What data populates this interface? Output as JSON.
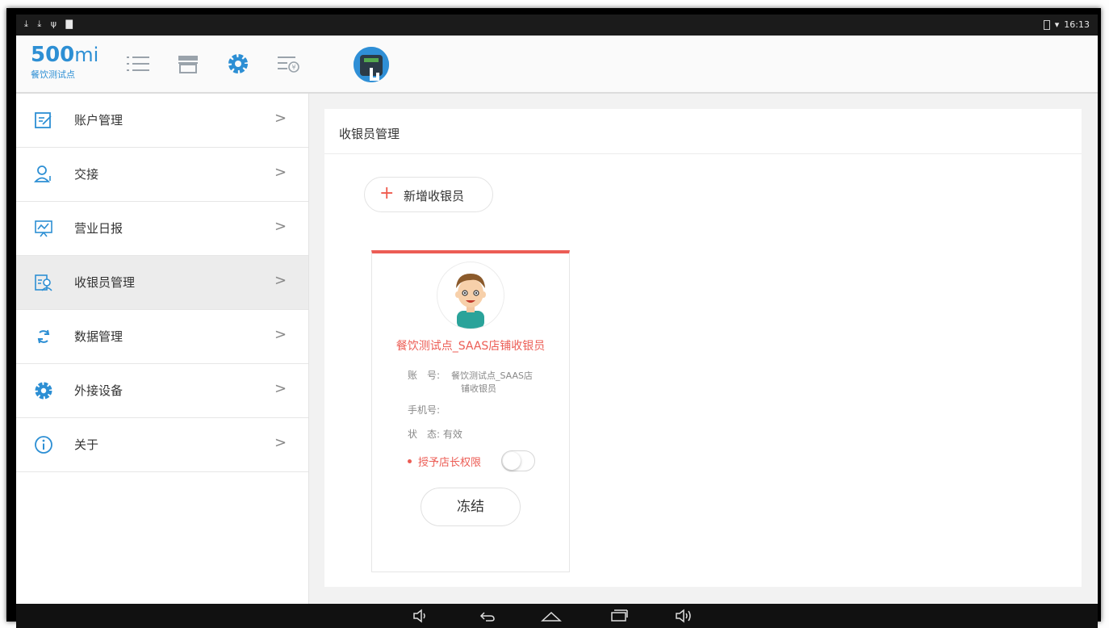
{
  "status_bar": {
    "left_icons": [
      "download-icon",
      "download-icon",
      "usb-icon",
      "image-icon"
    ],
    "battery_icon": "battery-icon",
    "wifi_icon": "wifi-icon",
    "time": "16:13"
  },
  "app": {
    "logo_number": "500",
    "logo_mi": "mi",
    "store_name": "餐饮测试点",
    "top_icons": [
      "list-icon",
      "store-icon",
      "gear-icon",
      "cash-register-icon"
    ]
  },
  "sidebar": {
    "items": [
      {
        "label": "账户管理",
        "icon": "edit-icon",
        "arrow": ">"
      },
      {
        "label": "交接",
        "icon": "user-handover-icon",
        "arrow": ">"
      },
      {
        "label": "营业日报",
        "icon": "report-icon",
        "arrow": ">"
      },
      {
        "label": "收银员管理",
        "icon": "cashier-icon",
        "arrow": ">"
      },
      {
        "label": "数据管理",
        "icon": "sync-icon",
        "arrow": ">"
      },
      {
        "label": "外接设备",
        "icon": "gear-icon",
        "arrow": ">"
      },
      {
        "label": "关于",
        "icon": "info-icon",
        "arrow": ">"
      }
    ],
    "active_index": 3
  },
  "content": {
    "title": "收银员管理",
    "add_button": {
      "icon": "+",
      "label": "新增收银员"
    },
    "cashier": {
      "name": "餐饮测试点_SAAS店铺收银员",
      "account_label": "账　号:",
      "account_value_line1": "餐饮测试点_SAAS店",
      "account_value_line2": "铺收银员",
      "phone_label": "手机号:",
      "phone_value": "",
      "status_label": "状　态:",
      "status_value": "有效",
      "permission_label": "授予店长权限",
      "permission_enabled": false,
      "freeze_button": "冻结"
    }
  },
  "colors": {
    "accent_blue": "#2d8fd4",
    "accent_red": "#ec5d55"
  }
}
